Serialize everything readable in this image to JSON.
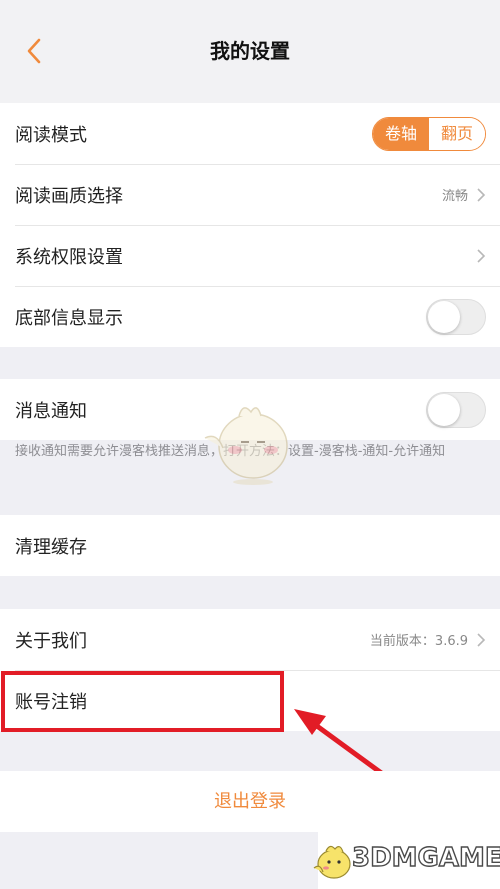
{
  "header": {
    "title": "我的设置",
    "back_icon": "chevron-left-icon"
  },
  "accent_color": "#f08a3c",
  "group1": {
    "reading_mode": {
      "label": "阅读模式",
      "options": [
        "卷轴",
        "翻页"
      ],
      "selected": "卷轴"
    },
    "quality": {
      "label": "阅读画质选择",
      "value": "流畅"
    },
    "permissions": {
      "label": "系统权限设置"
    },
    "bottom_info": {
      "label": "底部信息显示",
      "enabled": false
    }
  },
  "notifications": {
    "label": "消息通知",
    "enabled": false,
    "hint": "接收通知需要允许漫客栈推送消息，打开方法：设置-漫客栈-通知-允许通知"
  },
  "cache": {
    "label": "清理缓存"
  },
  "about": {
    "label": "关于我们",
    "version": "当前版本：3.6.9"
  },
  "account_cancel": {
    "label": "账号注销"
  },
  "logout": {
    "label": "退出登录"
  },
  "watermark": {
    "text": "3DMGAME"
  }
}
